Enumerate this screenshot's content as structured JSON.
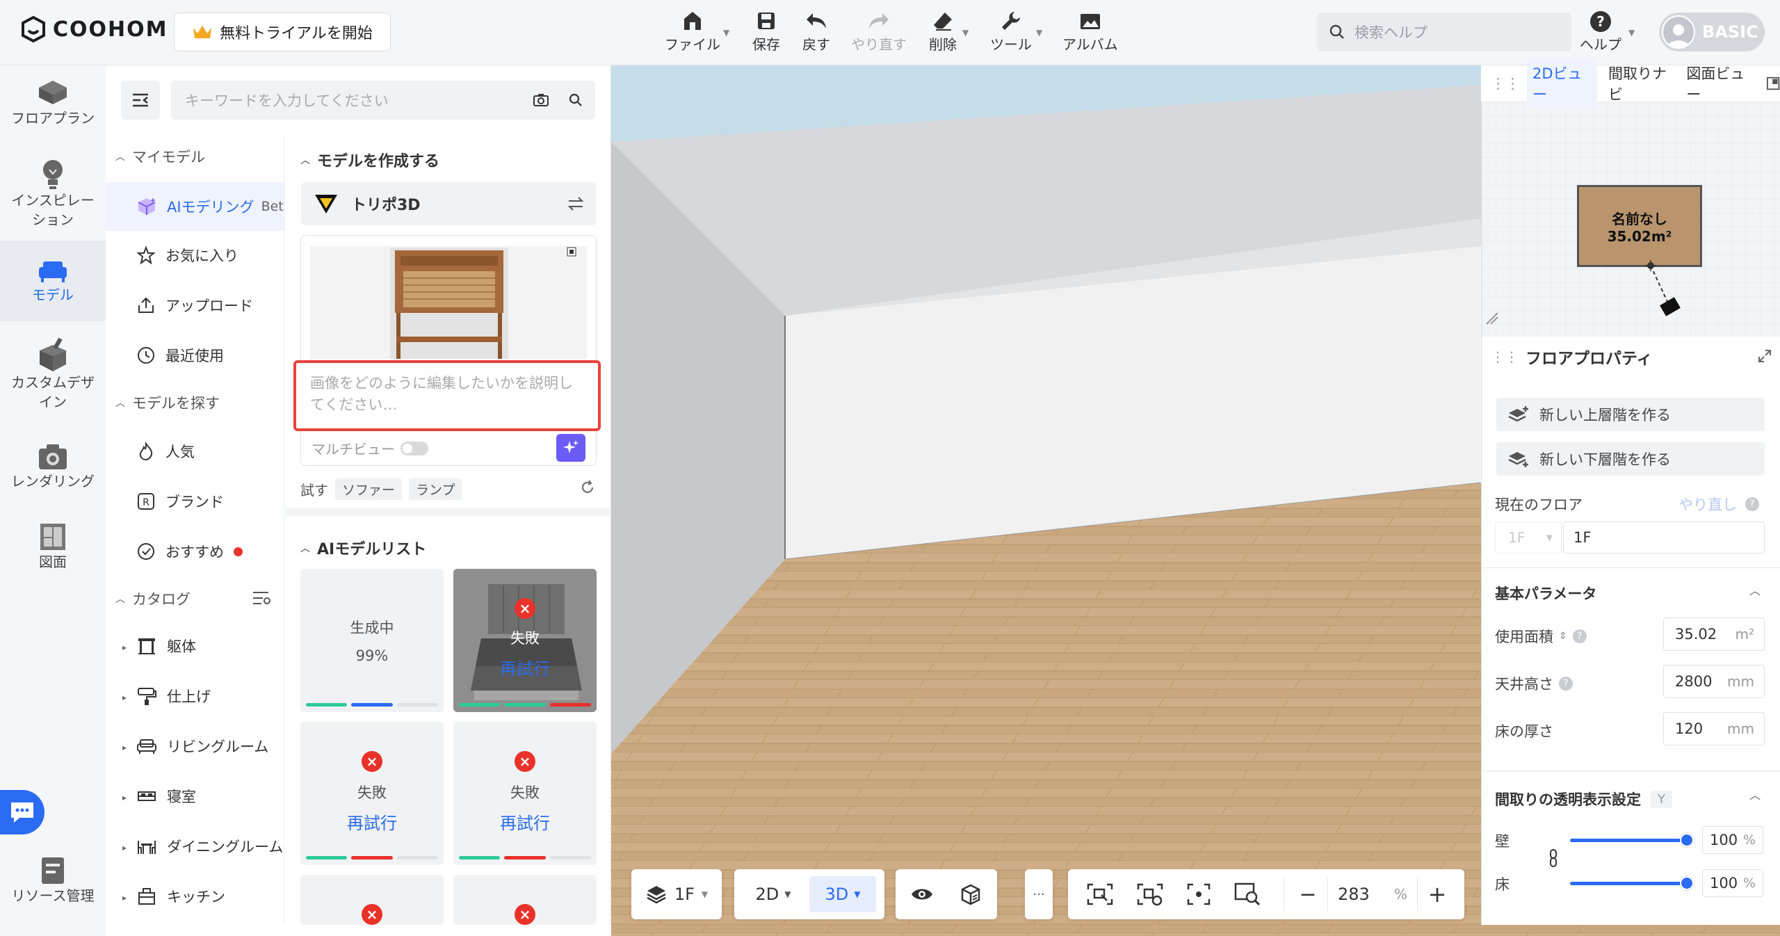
{
  "app": {
    "logo_text": "COOHOM",
    "trial_button": "無料トライアルを開始"
  },
  "toolbar": {
    "file": "ファイル",
    "save": "保存",
    "undo": "戻す",
    "redo": "やり直す",
    "delete": "削除",
    "tools": "ツール",
    "album": "アルバム"
  },
  "header": {
    "search_placeholder": "検索ヘルプ",
    "help": "ヘルプ",
    "plan_badge": "BASIC"
  },
  "leftnav": {
    "floorplan": "フロアプラン",
    "inspiration": "インスピレーション",
    "models": "モデル",
    "custom_design": "カスタムデザイン",
    "rendering": "レンダリング",
    "drawing": "図面",
    "resources": "リソース管理"
  },
  "panel": {
    "search_placeholder": "キーワードを入力してください",
    "my_models": "マイモデル",
    "ai_modeling": "AIモデリング",
    "beta": "Bet",
    "favorites": "お気に入り",
    "upload": "アップロード",
    "recent": "最近使用",
    "find_models": "モデルを探す",
    "popular": "人気",
    "brand": "ブランド",
    "recommended": "おすすめ",
    "catalog": "カタログ",
    "structure": "躯体",
    "finishing": "仕上げ",
    "living": "リビングルーム",
    "bedroom": "寝室",
    "dining": "ダイニングルーム",
    "kitchen": "キッチン",
    "create_model": "モデルを作成する",
    "tripo": "トリポ3D",
    "prompt_placeholder": "画像をどのように編集したいかを説明してください…",
    "multiview": "マルチビュー",
    "try": "試す",
    "try_chips": [
      "ソファー",
      "ランプ"
    ],
    "ai_list": "AIモデルリスト",
    "cards": [
      {
        "status": "生成中",
        "progress": "99%"
      },
      {
        "status": "失敗",
        "retry": "再試行"
      },
      {
        "status": "失敗",
        "retry": "再試行"
      },
      {
        "status": "失敗",
        "retry": "再試行"
      }
    ]
  },
  "bottombar": {
    "floor": "1F",
    "mode_2d": "2D",
    "mode_3d": "3D",
    "more": "···",
    "zoom": "283",
    "zoom_unit": "%"
  },
  "navpanel": {
    "tab_2d": "2Dビュー",
    "tab_layout": "間取りナビ",
    "tab_plan": "図面ビュー",
    "room_name": "名前なし",
    "room_area": "35.02m²"
  },
  "props": {
    "title": "フロアプロパティ",
    "new_upper": "新しい上層階を作る",
    "new_lower": "新しい下層階を作る",
    "current_floor": "現在のフロア",
    "redo": "やり直し",
    "floor_prefix": "1F",
    "floor_value": "1F",
    "basic_params": "基本パラメータ",
    "area_label": "使用面積",
    "area_value": "35.02",
    "area_unit": "m²",
    "ceiling_label": "天井高さ",
    "ceiling_value": "2800",
    "ceiling_unit": "mm",
    "floor_thick_label": "床の厚さ",
    "floor_thick_value": "120",
    "floor_thick_unit": "mm",
    "transparency": "間取りの透明表示設定",
    "y_key": "Y",
    "wall": "壁",
    "wall_value": "100",
    "floor": "床",
    "floor_value_pct": "100",
    "pct": "%"
  },
  "colors": {
    "accent": "#2b6bf3",
    "error": "#e8322a",
    "highlight_box": "#e8433b"
  }
}
